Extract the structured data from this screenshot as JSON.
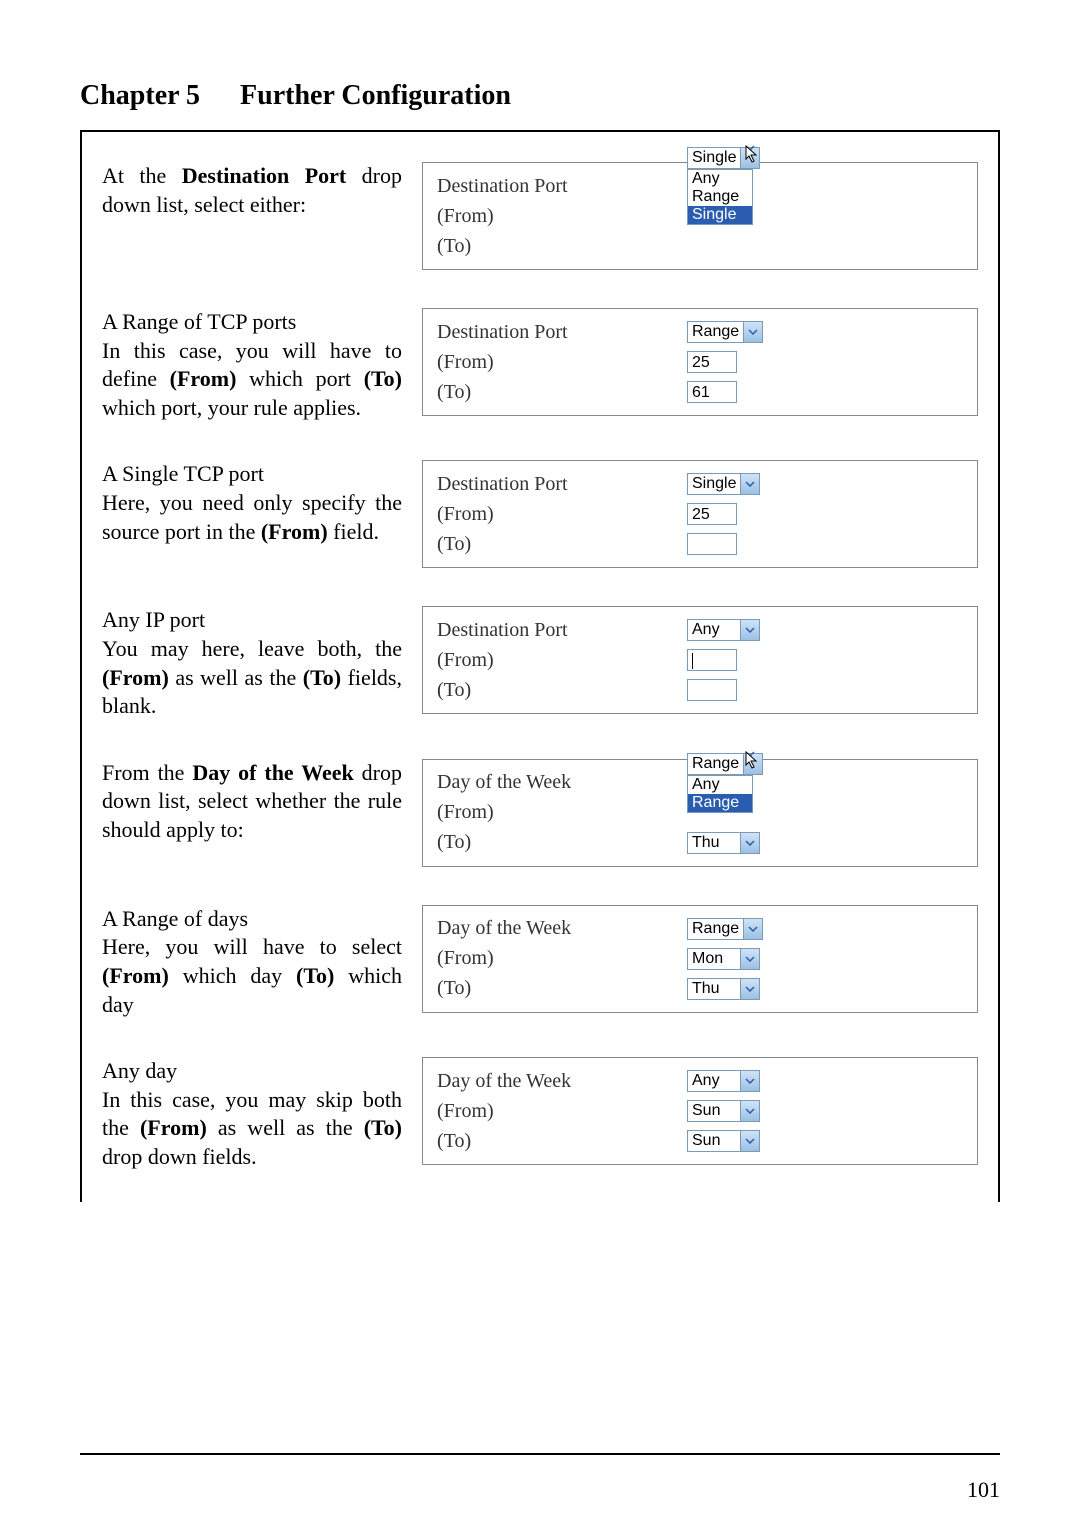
{
  "header": {
    "chapter": "Chapter 5",
    "title": "Further Configuration"
  },
  "page_number": "101",
  "labels": {
    "dest_port": "Destination Port",
    "from": "(From)",
    "to": "(To)",
    "day_of_week": "Day of the Week"
  },
  "rows": [
    {
      "desc_parts": [
        "At the ",
        {
          "b": "Destination Port"
        },
        " drop down list, select either:"
      ],
      "panel": "dest_dropdown_open"
    },
    {
      "desc_parts": [
        "A Range of TCP ports\nIn this case, you will have to define ",
        {
          "b": "(From)"
        },
        " which port ",
        {
          "b": "(To)"
        },
        " which port, your rule applies."
      ],
      "panel": "dest_range"
    },
    {
      "desc_parts": [
        "A Single TCP port\nHere, you need only specify the source port in the ",
        {
          "b": "(From)"
        },
        " field."
      ],
      "panel": "dest_single"
    },
    {
      "desc_parts": [
        "Any IP port\nYou may here, leave both, the ",
        {
          "b": "(From)"
        },
        " as well as the ",
        {
          "b": "(To)"
        },
        " fields, blank."
      ],
      "panel": "dest_any"
    },
    {
      "desc_parts": [
        "From the ",
        {
          "b": "Day of the Week"
        },
        " drop down list, select whether the rule should apply to:"
      ],
      "panel": "dow_dropdown_open"
    },
    {
      "desc_parts": [
        "A Range of days\nHere, you will have to select ",
        {
          "b": "(From)"
        },
        " which day ",
        {
          "b": "(To)"
        },
        " which day"
      ],
      "panel": "dow_range"
    },
    {
      "desc_parts": [
        "Any day\nIn this case, you may skip both the ",
        {
          "b": "(From)"
        },
        " as well as the ",
        {
          "b": "(To)"
        },
        " drop down fields."
      ],
      "panel": "dow_any"
    }
  ],
  "panels": {
    "dest_dropdown_open": {
      "type": "port",
      "main_value": "Single",
      "list": [
        "Any",
        "Range",
        "Single"
      ],
      "list_selected": "Single",
      "cursor": true
    },
    "dest_range": {
      "type": "port",
      "main_value": "Range",
      "from_value": "25",
      "to_value": "61"
    },
    "dest_single": {
      "type": "port",
      "main_value": "Single",
      "from_value": "25",
      "to_value": ""
    },
    "dest_any": {
      "type": "port",
      "main_value": "Any",
      "from_value": "",
      "to_value": "",
      "caret_in_from": true
    },
    "dow_dropdown_open": {
      "type": "dow",
      "main_value": "Range",
      "list": [
        "Any",
        "Range"
      ],
      "list_selected": "Range",
      "to_dd": "Thu",
      "cursor": true
    },
    "dow_range": {
      "type": "dow",
      "main_value": "Range",
      "from_dd": "Mon",
      "to_dd": "Thu"
    },
    "dow_any": {
      "type": "dow",
      "main_value": "Any",
      "from_dd": "Sun",
      "to_dd": "Sun"
    }
  }
}
